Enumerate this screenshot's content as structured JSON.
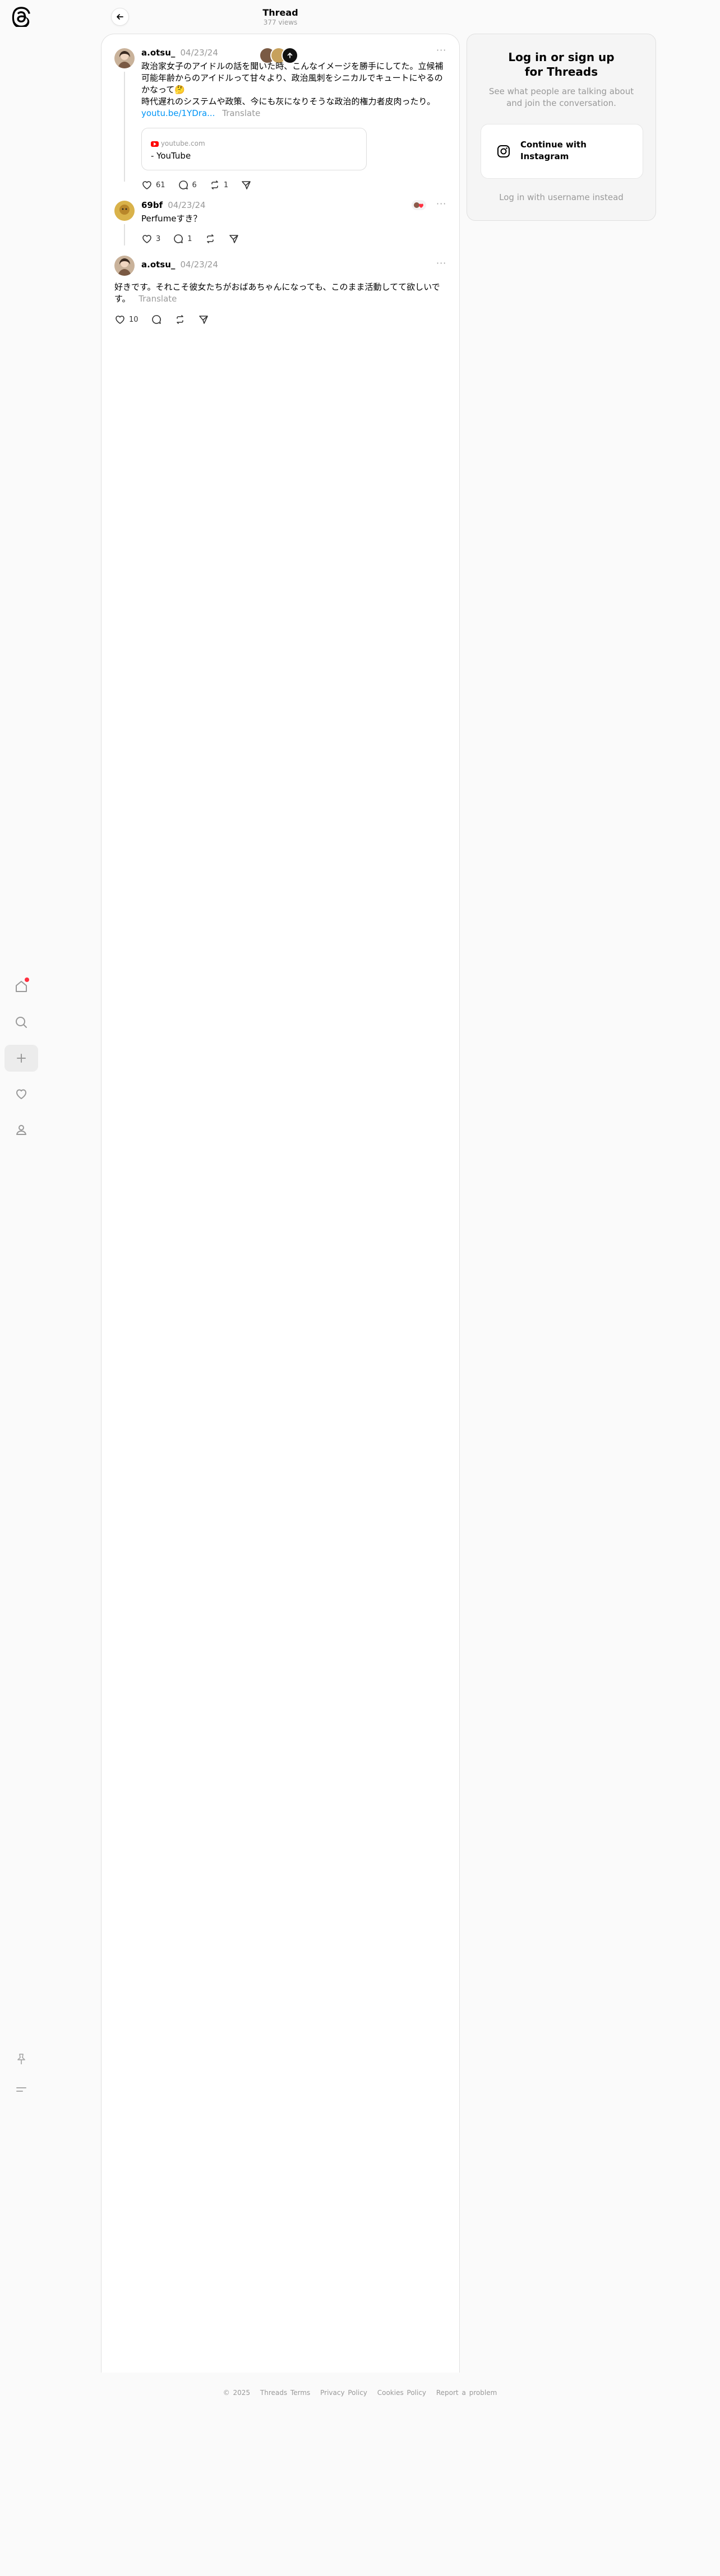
{
  "header": {
    "title": "Thread",
    "views": "377 views"
  },
  "posts": [
    {
      "username": "a.otsu_",
      "date": "04/23/24",
      "text_line1": "政治家女子のアイドルの話を聞いた時、こんなイメージを勝手にしてた。立候補",
      "text_line2": "可能年齢からのアイドルって甘々より、政治風刺をシニカルでキュートにやるの",
      "text_line3": "かなって🤔",
      "text_line4": "時代遅れのシステムや政策、今にも灰になりそうな政治的権力者皮肉ったり。",
      "link_text": "youtu.be/1YDra...",
      "translate": "Translate",
      "preview_domain": "youtube.com",
      "preview_title": "- YouTube",
      "likes": "61",
      "replies": "6",
      "reposts": "1"
    },
    {
      "username": "69bf",
      "date": "04/23/24",
      "text": "Perfumeすき？",
      "likes": "3",
      "replies": "1"
    },
    {
      "username": "a.otsu_",
      "date": "04/23/24",
      "text_line1": "好きです。それこそ彼女たちがおばあちゃんになっても、このまま活動してて欲しいで",
      "text_line2": "す。",
      "translate": "Translate",
      "likes": "10"
    }
  ],
  "login": {
    "title_line1": "Log in or sign up",
    "title_line2": "for Threads",
    "subtitle": "See what people are talking about and join the conversation.",
    "instagram_line1": "Continue with",
    "instagram_line2": "Instagram",
    "username_login": "Log in with username instead"
  },
  "footer": {
    "copyright": "© 2025",
    "terms": "Threads Terms",
    "privacy": "Privacy Policy",
    "cookies": "Cookies Policy",
    "report": "Report a problem"
  },
  "icons": {
    "logo": "threads-logo-icon",
    "home": "home-icon",
    "search": "search-icon",
    "create": "plus-icon",
    "activity": "heart-icon",
    "profile": "profile-icon",
    "pin": "pin-icon",
    "menu": "menu-icon"
  },
  "colors": {
    "accent_link": "#0095f6",
    "notification": "#ff3040",
    "muted": "#999999"
  }
}
